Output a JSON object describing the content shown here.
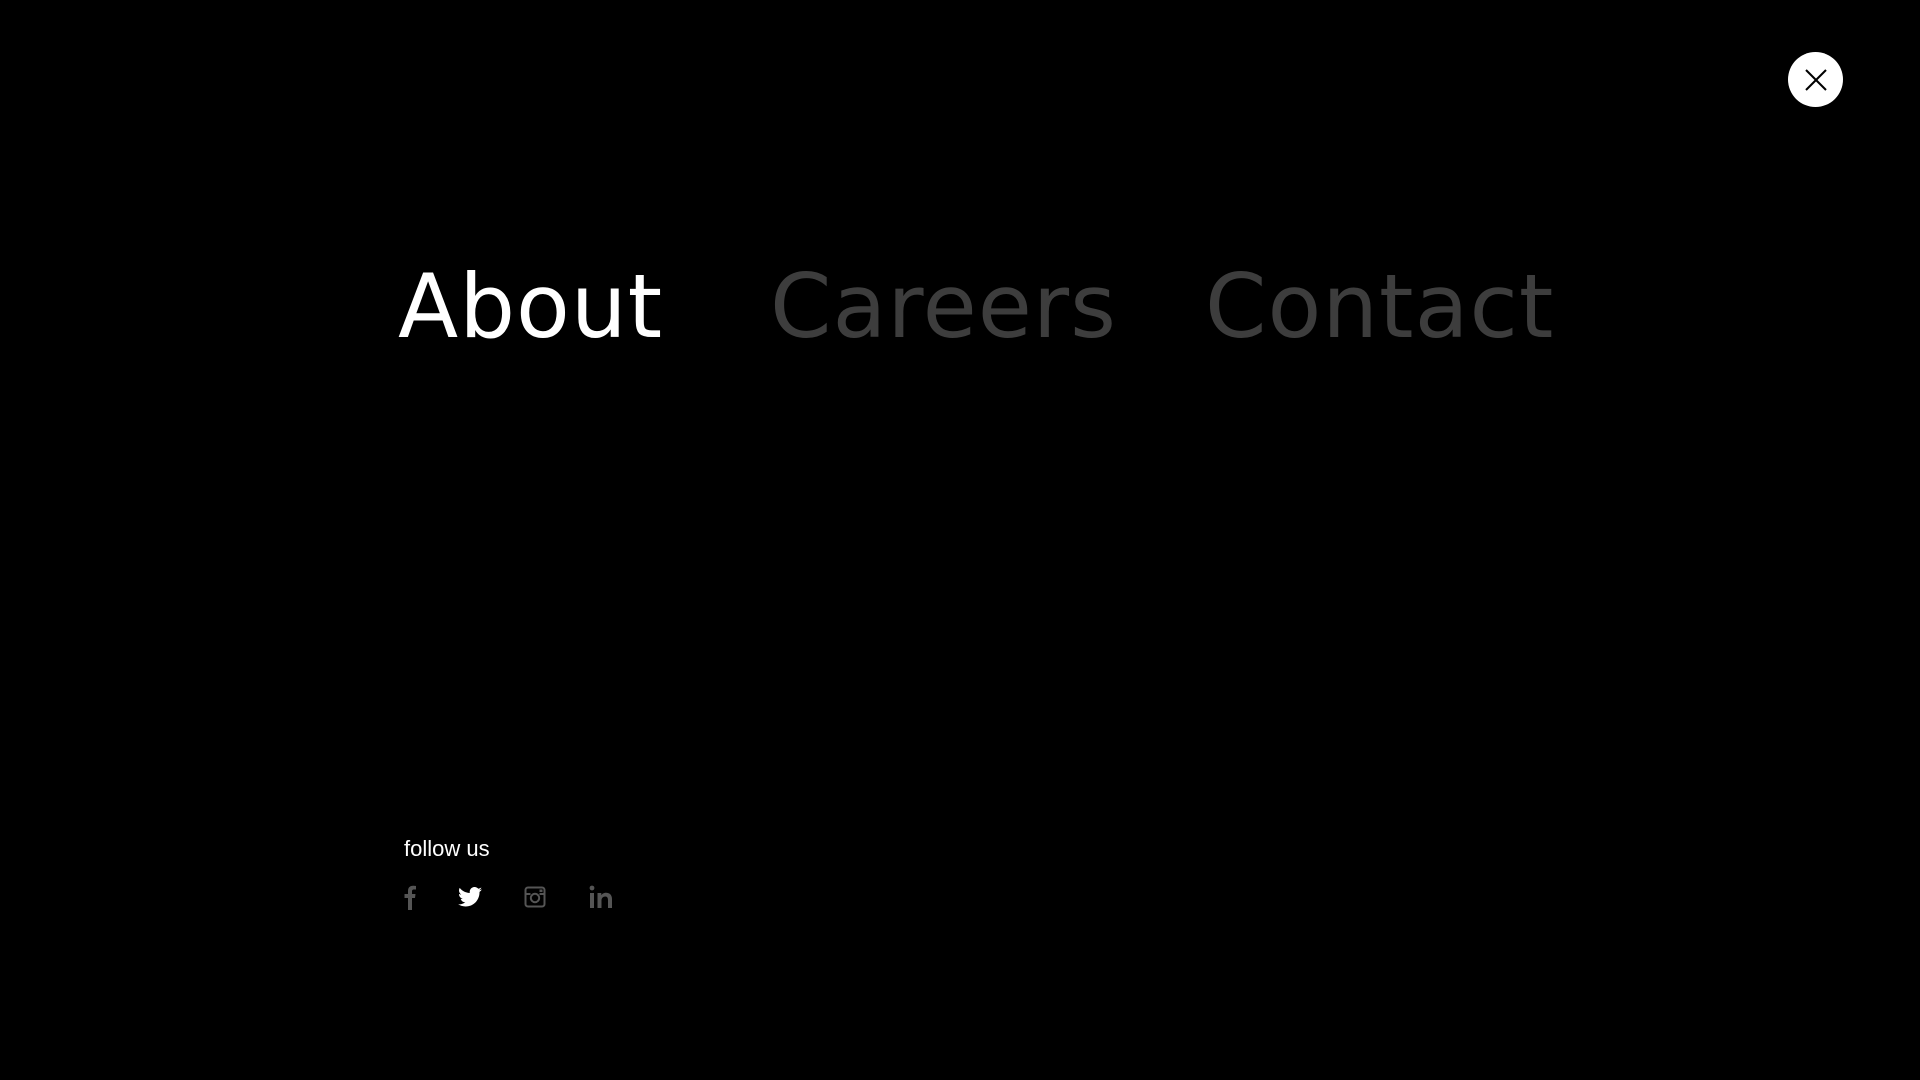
{
  "menu": {
    "items": [
      {
        "label": "About",
        "state": "active"
      },
      {
        "label": "Careers",
        "state": "inactive"
      },
      {
        "label": "Contact",
        "state": "inactive"
      }
    ]
  },
  "close": {
    "icon": "close-icon"
  },
  "follow": {
    "label": "follow us",
    "socials": [
      {
        "icon": "facebook-icon",
        "color": "#555555"
      },
      {
        "icon": "twitter-icon",
        "color": "#ffffff"
      },
      {
        "icon": "instagram-icon",
        "color": "#555555"
      },
      {
        "icon": "linkedin-icon",
        "color": "#555555"
      }
    ]
  },
  "colors": {
    "background": "#000000",
    "active": "#ffffff",
    "inactive": "#3d3d3d"
  }
}
